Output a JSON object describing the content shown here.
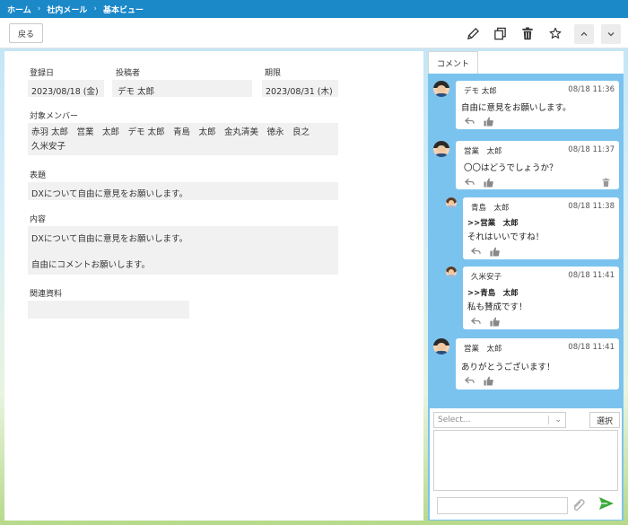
{
  "breadcrumb": {
    "items": [
      "ホーム",
      "社内メール",
      "基本ビュー"
    ]
  },
  "toolbar": {
    "back_label": "戻る",
    "icons": [
      "edit-icon",
      "copy-icon",
      "trash-icon",
      "star-icon",
      "chevron-up-icon",
      "chevron-down-icon"
    ]
  },
  "form": {
    "registered": {
      "label": "登録日",
      "value": "2023/08/18 (金)"
    },
    "poster": {
      "label": "投稿者",
      "value": "デモ 太郎"
    },
    "deadline": {
      "label": "期限",
      "value": "2023/08/31 (木)"
    },
    "members": {
      "label": "対象メンバー",
      "line1": "赤羽 太郎　営業　太郎　デモ 太郎　青島　太郎　金丸清美　徳永　良之",
      "line2": "久米安子"
    },
    "subject": {
      "label": "表題",
      "value": "DXについて自由に意見をお願いします。"
    },
    "content": {
      "label": "内容",
      "line1": "DXについて自由に意見をお願いします。",
      "line2": "自由にコメントお願いします。"
    },
    "attachments": {
      "label": "関連資料",
      "value": ""
    }
  },
  "comments_panel": {
    "tab_label": "コメント",
    "comments": [
      {
        "name": "デモ 太郎",
        "date": "08/18 11:36",
        "quote": "",
        "text": "自由に意見をお願いします。"
      },
      {
        "name": "営業　太郎",
        "date": "08/18 11:37",
        "quote": "",
        "text": "〇〇はどうでしょうか？"
      },
      {
        "name": "青島　太郎",
        "date": "08/18 11:38",
        "quote": ">>営業　太郎",
        "text": "それはいいですね！"
      },
      {
        "name": "久米安子",
        "date": "08/18 11:41",
        "quote": ">>青島　太郎",
        "text": "私も賛成です！"
      },
      {
        "name": "営業　太郎",
        "date": "08/18 11:41",
        "quote": "",
        "text": "ありがとうございます！"
      }
    ],
    "compose": {
      "select_placeholder": "Select...",
      "choose_label": "選択"
    }
  },
  "colors": {
    "topbar": "#1b88c8",
    "panel": "#7bc3ef",
    "send": "#3cab3c"
  }
}
